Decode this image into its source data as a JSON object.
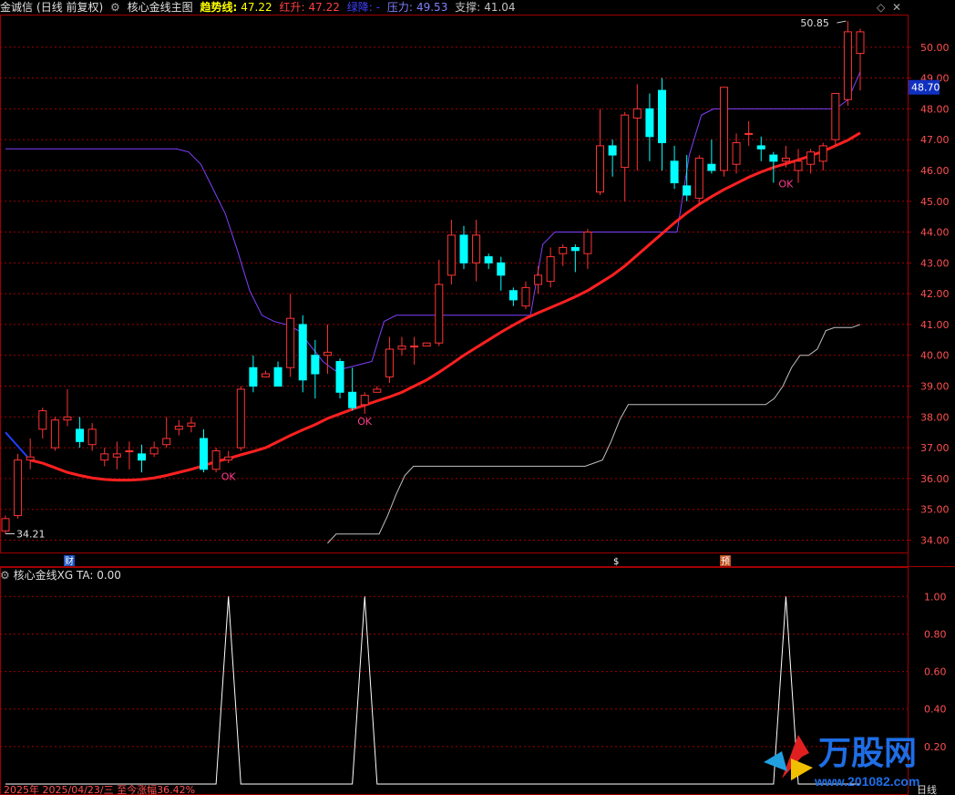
{
  "header": {
    "stock": "金诚信",
    "period": "(日线 前复权)",
    "indicator": "核心金线主图",
    "trend_label": "趋势线:",
    "trend_value": "47.22",
    "red_label": "红升:",
    "red_value": "47.22",
    "green_label": "绿降:",
    "pressure_label": "压力:",
    "pressure_value": "49.53",
    "support_label": "支撑:",
    "support_value": "41.04"
  },
  "sub_header": {
    "name": "核心金线XG",
    "ta": "TA: 0.00"
  },
  "markers": {
    "high_label": "50.85",
    "low_label": "34.21",
    "current_price": "48.70",
    "ok_labels": [
      "OK",
      "OK",
      "OK"
    ],
    "event_cai": "财",
    "event_dollar": "$",
    "event_yu": "预"
  },
  "footer": {
    "date_text": "2025年 2025/04/23/三 至今涨幅36.42%",
    "period_text": "日线"
  },
  "watermark": {
    "text": "万股网",
    "url": "www.201082.com"
  },
  "colors": {
    "up": "#ff3333",
    "down": "#00ffff",
    "trend": "#ff2020",
    "pressure": "#8040ff",
    "support": "#c0c0c0",
    "grid": "#a00000"
  },
  "chart_data": [
    {
      "type": "candlestick",
      "title": "核心金线主图",
      "ylim": [
        33.6,
        51.0
      ],
      "y_ticks": [
        "34.00",
        "35.00",
        "36.00",
        "37.00",
        "38.00",
        "39.00",
        "40.00",
        "41.00",
        "42.00",
        "43.00",
        "44.00",
        "45.00",
        "46.00",
        "47.00",
        "48.00",
        "49.00",
        "50.00"
      ],
      "candles": [
        [
          34.3,
          34.7,
          34.2,
          34.8
        ],
        [
          34.8,
          36.6,
          34.7,
          36.8
        ],
        [
          36.6,
          36.7,
          36.3,
          37.3
        ],
        [
          37.6,
          38.2,
          37.3,
          38.3
        ],
        [
          37.0,
          37.9,
          36.9,
          38.0
        ],
        [
          37.9,
          38.0,
          37.7,
          38.9
        ],
        [
          37.6,
          37.2,
          37.0,
          38.0
        ],
        [
          37.1,
          37.6,
          36.9,
          37.8
        ],
        [
          36.6,
          36.8,
          36.4,
          37.0
        ],
        [
          36.7,
          36.8,
          36.3,
          37.2
        ],
        [
          36.9,
          36.9,
          36.3,
          37.2
        ],
        [
          36.8,
          36.6,
          36.2,
          37.1
        ],
        [
          36.8,
          37.0,
          36.7,
          37.2
        ],
        [
          37.1,
          37.3,
          37.0,
          38.0
        ],
        [
          37.6,
          37.7,
          37.4,
          37.9
        ],
        [
          37.7,
          37.8,
          37.5,
          38.0
        ],
        [
          37.3,
          36.3,
          36.2,
          37.6
        ],
        [
          36.3,
          36.9,
          36.2,
          37.0
        ],
        [
          36.6,
          36.7,
          36.5,
          36.9
        ],
        [
          37.0,
          38.9,
          36.9,
          39.0
        ],
        [
          39.6,
          39.0,
          38.8,
          40.0
        ],
        [
          39.3,
          39.4,
          39.3,
          39.5
        ],
        [
          39.6,
          39.0,
          39.0,
          39.8
        ],
        [
          39.6,
          41.2,
          39.3,
          42.0
        ],
        [
          41.0,
          39.2,
          38.8,
          41.3
        ],
        [
          40.0,
          39.4,
          38.6,
          40.5
        ],
        [
          40.0,
          40.1,
          39.4,
          41.0
        ],
        [
          39.8,
          38.8,
          38.6,
          39.9
        ],
        [
          38.8,
          38.3,
          38.2,
          39.6
        ],
        [
          38.4,
          38.7,
          38.1,
          38.8
        ],
        [
          38.8,
          38.9,
          38.8,
          39.0
        ],
        [
          39.3,
          40.2,
          39.1,
          40.6
        ],
        [
          40.2,
          40.3,
          40.0,
          40.6
        ],
        [
          40.3,
          40.3,
          39.7,
          40.6
        ],
        [
          40.3,
          40.4,
          40.3,
          40.4
        ],
        [
          40.4,
          42.3,
          40.3,
          43.1
        ],
        [
          42.6,
          43.9,
          42.3,
          44.4
        ],
        [
          43.9,
          43.0,
          42.8,
          44.2
        ],
        [
          43.0,
          43.9,
          42.4,
          44.4
        ],
        [
          43.2,
          43.0,
          42.8,
          43.3
        ],
        [
          43.0,
          42.6,
          42.1,
          43.2
        ],
        [
          42.1,
          41.8,
          41.6,
          42.2
        ],
        [
          41.6,
          42.2,
          41.5,
          42.4
        ],
        [
          42.3,
          42.6,
          42.0,
          42.9
        ],
        [
          42.4,
          43.2,
          42.2,
          43.5
        ],
        [
          43.3,
          43.5,
          42.9,
          43.6
        ],
        [
          43.5,
          43.4,
          42.7,
          43.6
        ],
        [
          43.3,
          44.0,
          42.8,
          44.1
        ],
        [
          45.3,
          46.8,
          45.2,
          48.0
        ],
        [
          46.8,
          46.5,
          45.8,
          47.0
        ],
        [
          46.1,
          47.8,
          45.0,
          47.9
        ],
        [
          47.7,
          48.0,
          46.0,
          48.8
        ],
        [
          48.0,
          47.1,
          46.3,
          48.5
        ],
        [
          48.6,
          46.9,
          46.0,
          49.0
        ],
        [
          46.3,
          45.6,
          45.4,
          46.8
        ],
        [
          45.5,
          45.2,
          45.0,
          46.5
        ],
        [
          45.1,
          46.4,
          44.9,
          46.5
        ],
        [
          46.2,
          46.0,
          45.9,
          47.0
        ],
        [
          46.0,
          48.7,
          45.8,
          48.7
        ],
        [
          46.2,
          46.9,
          45.9,
          47.2
        ],
        [
          47.2,
          47.2,
          46.8,
          47.6
        ],
        [
          46.8,
          46.7,
          46.3,
          47.1
        ],
        [
          46.5,
          46.3,
          45.6,
          46.6
        ],
        [
          46.3,
          46.4,
          46.1,
          46.8
        ],
        [
          46.0,
          46.3,
          45.6,
          46.7
        ],
        [
          46.2,
          46.6,
          45.9,
          46.7
        ],
        [
          46.3,
          46.8,
          46.0,
          46.9
        ],
        [
          47.0,
          48.5,
          46.8,
          48.5
        ],
        [
          48.3,
          50.5,
          48.1,
          50.85
        ],
        [
          49.8,
          50.5,
          48.6,
          50.6
        ]
      ],
      "trend": [
        36.6,
        36.5,
        36.35,
        36.2,
        36.1,
        36.02,
        35.97,
        35.95,
        35.95,
        35.97,
        36.02,
        36.1,
        36.2,
        36.3,
        36.42,
        36.55,
        36.65,
        36.77,
        36.88,
        37.0,
        37.2,
        37.4,
        37.58,
        37.75,
        37.95,
        38.1,
        38.25,
        38.38,
        38.52,
        38.65,
        38.8,
        39.0,
        39.2,
        39.45,
        39.72,
        40.0,
        40.25,
        40.5,
        40.75,
        40.98,
        41.2,
        41.38,
        41.55,
        41.72,
        41.9,
        42.1,
        42.35,
        42.6,
        42.9,
        43.25,
        43.6,
        43.95,
        44.3,
        44.62,
        44.9,
        45.15,
        45.38,
        45.58,
        45.78,
        45.95,
        46.1,
        46.22,
        46.34,
        46.48,
        46.62,
        46.8,
        46.98,
        47.22
      ],
      "pressure": [
        46.7,
        46.7,
        46.7,
        46.7,
        46.7,
        46.7,
        46.7,
        46.7,
        46.7,
        46.7,
        46.7,
        46.7,
        46.7,
        46.7,
        46.7,
        46.6,
        46.2,
        45.4,
        44.6,
        43.4,
        42.1,
        41.3,
        41.1,
        41.0,
        40.8,
        40.3,
        39.8,
        39.5,
        39.6,
        39.7,
        39.8,
        41.1,
        41.3,
        41.3,
        41.3,
        41.3,
        41.3,
        41.3,
        41.3,
        41.3,
        41.3,
        41.3,
        41.3,
        41.3,
        43.6,
        44.0,
        44.0,
        44.0,
        44.0,
        44.0,
        44.0,
        44.0,
        44.0,
        44.0,
        44.0,
        44.0,
        46.5,
        47.8,
        48.0,
        48.0,
        48.0,
        48.0,
        48.0,
        48.0,
        48.0,
        48.0,
        48.0,
        48.0,
        48.0,
        48.3,
        49.2
      ],
      "support": [
        33.9,
        34.2,
        34.2,
        34.2,
        34.2,
        34.2,
        34.2,
        34.8,
        35.5,
        36.1,
        36.4,
        36.4,
        36.4,
        36.4,
        36.4,
        36.4,
        36.4,
        36.4,
        36.4,
        36.4,
        36.4,
        36.4,
        36.4,
        36.4,
        36.4,
        36.4,
        36.4,
        36.4,
        36.4,
        36.4,
        36.4,
        36.5,
        36.6,
        37.2,
        37.9,
        38.4,
        38.4,
        38.4,
        38.4,
        38.4,
        38.4,
        38.4,
        38.4,
        38.4,
        38.4,
        38.4,
        38.4,
        38.4,
        38.4,
        38.4,
        38.4,
        38.4,
        38.6,
        39.0,
        39.6,
        40.0,
        40.0,
        40.2,
        40.8,
        40.9,
        40.9,
        40.9,
        41.0
      ],
      "ok_points": [
        {
          "index": 18,
          "value": 36.6
        },
        {
          "index": 29,
          "value": 38.4
        },
        {
          "index": 63,
          "value": 46.1
        }
      ],
      "high": {
        "index": 68,
        "value": 50.85
      },
      "low": {
        "index": 0,
        "value": 34.21
      }
    },
    {
      "type": "line",
      "title": "核心金线XG",
      "ylim": [
        0,
        1.05
      ],
      "y_ticks": [
        "0.20",
        "0.40",
        "0.60",
        "0.80",
        "1.00"
      ],
      "spikes_at": [
        18,
        29,
        63
      ],
      "n": 70
    }
  ]
}
